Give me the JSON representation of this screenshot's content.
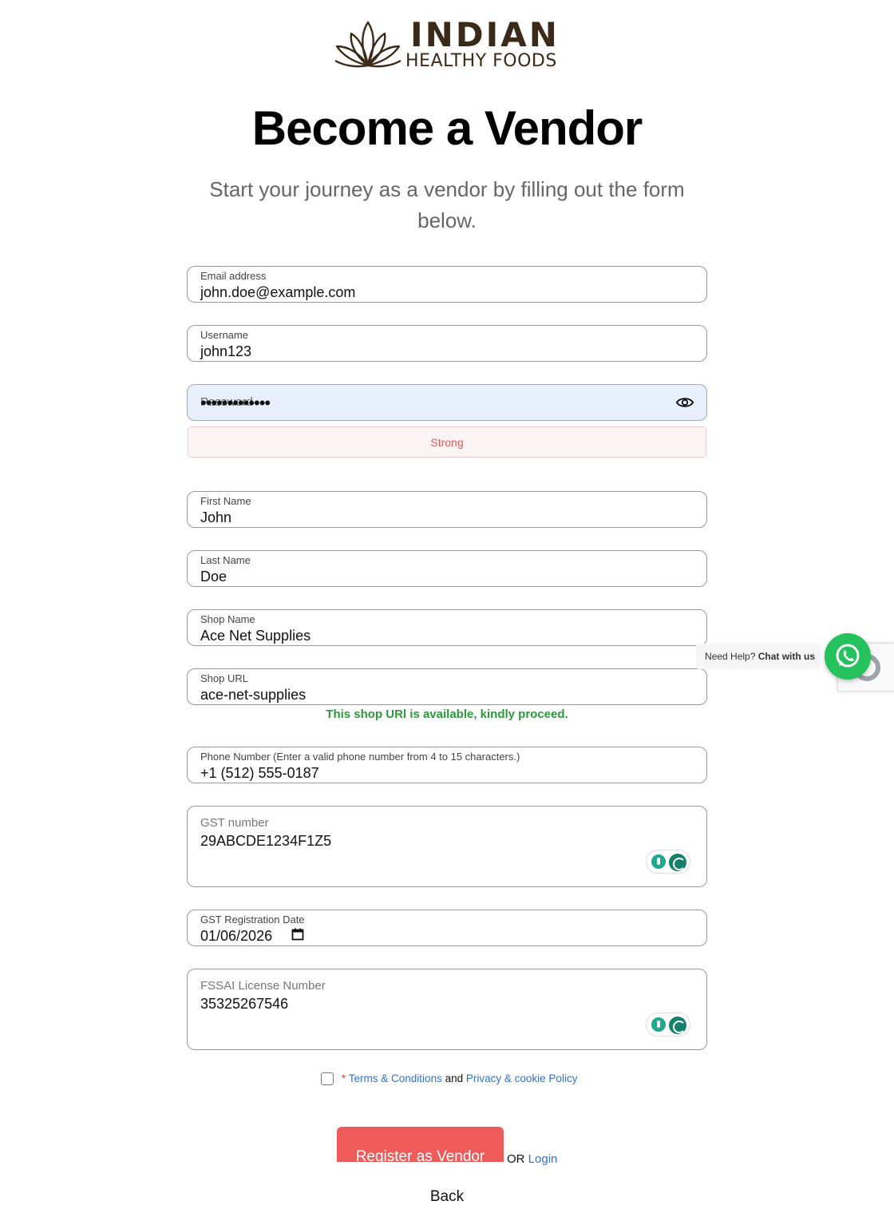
{
  "brand": {
    "line1": "INDIAN",
    "line2": "HEALTHY FOODS"
  },
  "page": {
    "title": "Become a Vendor",
    "subtitle": "Start your journey as a vendor by filling out the form below."
  },
  "form": {
    "email": {
      "label": "Email address",
      "value": "john.doe@example.com"
    },
    "username": {
      "label": "Username",
      "value": "john123"
    },
    "password": {
      "placeholder": "Password",
      "masked": "•••••••••••••",
      "strength": "Strong"
    },
    "first_name": {
      "label": "First Name",
      "value": "John"
    },
    "last_name": {
      "label": "Last Name",
      "value": "Doe"
    },
    "shop_name": {
      "label": "Shop Name",
      "value": "Ace Net Supplies"
    },
    "shop_url": {
      "label": "Shop URL",
      "value": "ace-net-supplies",
      "availability": "This shop URl is available, kindly proceed."
    },
    "phone": {
      "label": "Phone Number (Enter a valid phone number from 4 to 15 characters.)",
      "value": "+1 (512) 555-0187"
    },
    "gst_number": {
      "label": "GST number",
      "value": "29ABCDE1234F1Z5"
    },
    "gst_date": {
      "label": "GST Registration Date",
      "value": "01/06/2026"
    },
    "fssai": {
      "label": "FSSAI License Number",
      "value": "35325267546"
    }
  },
  "terms": {
    "required_mark": "*",
    "terms_link": "Terms & Conditions",
    "and": "and",
    "privacy_link": "Privacy & cookie Policy"
  },
  "actions": {
    "register": "Register as Vendor",
    "or": "OR",
    "login": "Login",
    "back": "Back"
  },
  "chat": {
    "need_help": "Need Help?",
    "chat_with_us": "Chat with us"
  },
  "colors": {
    "primary_button": "#ef5a5a",
    "link": "#3572c6",
    "success": "#2b9a3b",
    "whatsapp": "#25c15d"
  }
}
